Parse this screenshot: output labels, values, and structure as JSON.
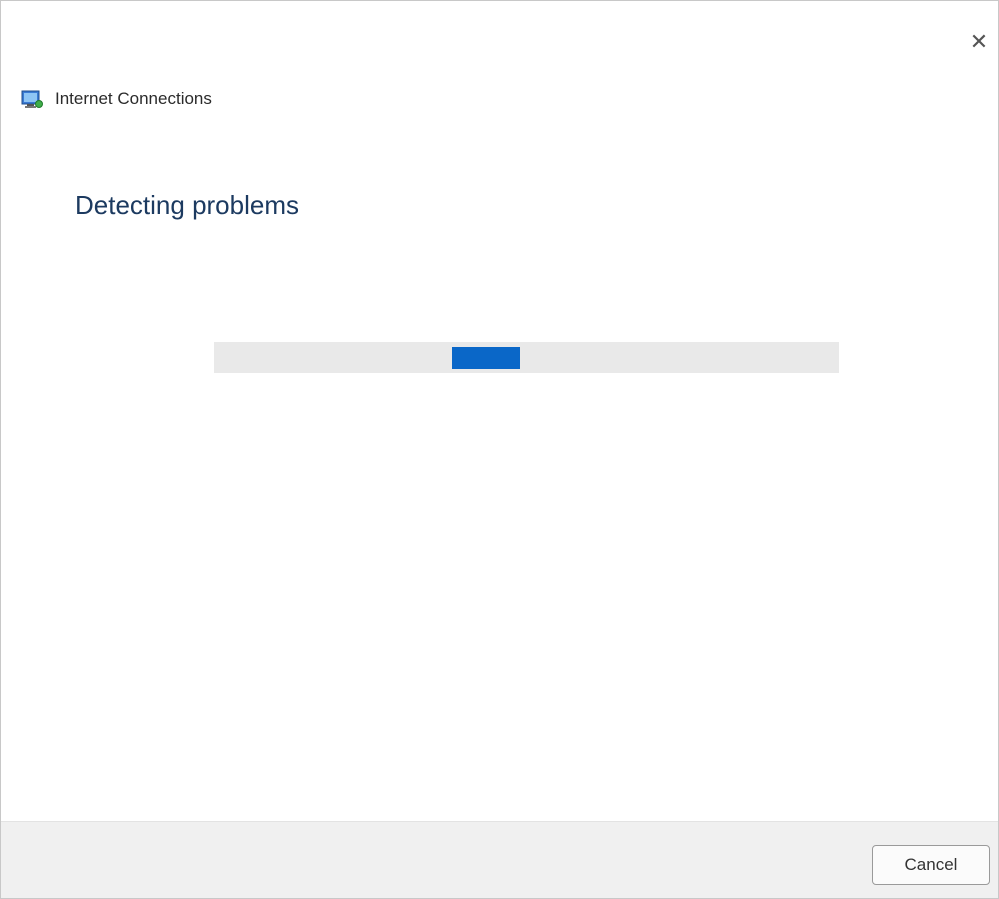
{
  "window": {
    "title": "Internet Connections",
    "close_icon": "close-icon",
    "app_icon": "network-connections-icon"
  },
  "main": {
    "heading": "Detecting problems",
    "progress": {
      "type": "indeterminate",
      "chunk_position_fraction": 0.38,
      "color": "#0a67c8"
    }
  },
  "footer": {
    "cancel_label": "Cancel"
  }
}
